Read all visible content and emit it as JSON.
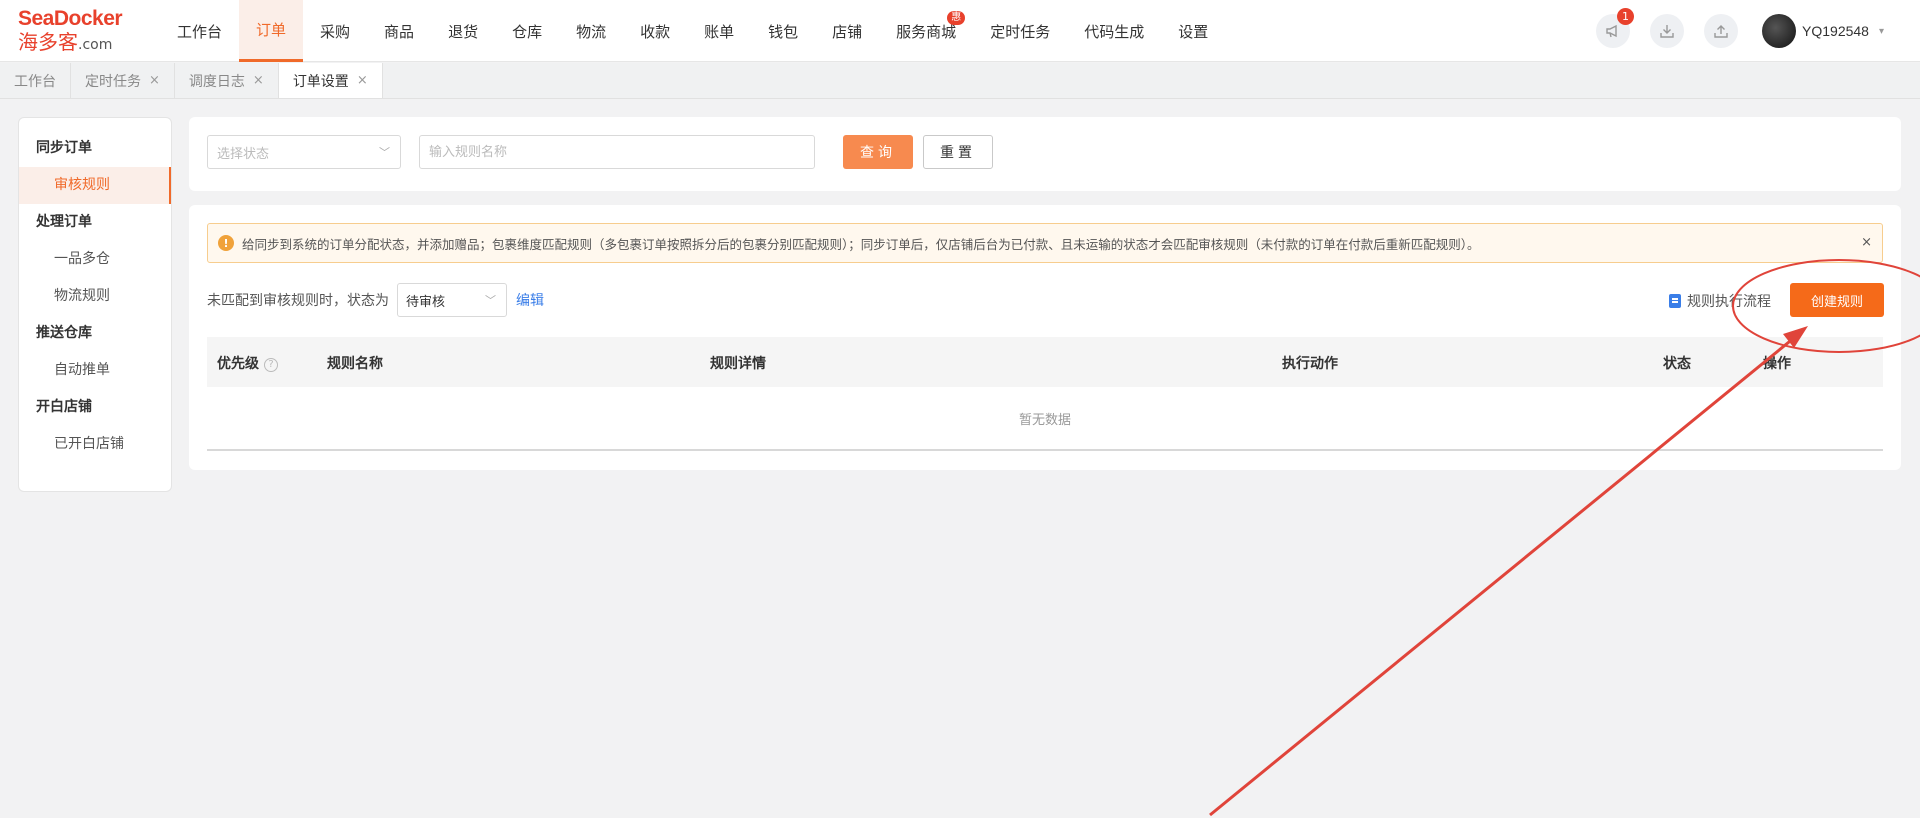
{
  "logo": {
    "line1_a": "Sea",
    "line1_b": "Docker",
    "line2_a": "海多客",
    "line2_b": ".com"
  },
  "nav": {
    "items": [
      {
        "label": "工作台"
      },
      {
        "label": "订单"
      },
      {
        "label": "采购"
      },
      {
        "label": "商品"
      },
      {
        "label": "退货"
      },
      {
        "label": "仓库"
      },
      {
        "label": "物流"
      },
      {
        "label": "收款"
      },
      {
        "label": "账单"
      },
      {
        "label": "钱包"
      },
      {
        "label": "店铺"
      },
      {
        "label": "服务商城",
        "badge": "惠"
      },
      {
        "label": "定时任务"
      },
      {
        "label": "代码生成"
      },
      {
        "label": "设置"
      }
    ],
    "active_index": 1
  },
  "toolbar": {
    "notice_badge": "1"
  },
  "user": {
    "name": "YQ192548"
  },
  "tabs": [
    {
      "label": "工作台",
      "closable": false
    },
    {
      "label": "定时任务",
      "closable": true
    },
    {
      "label": "调度日志",
      "closable": true
    },
    {
      "label": "订单设置",
      "closable": true,
      "active": true
    }
  ],
  "tab_close": "×",
  "sidebar": {
    "groups": [
      {
        "title": "同步订单",
        "items": [
          "审核规则"
        ]
      },
      {
        "title": "处理订单",
        "items": [
          "一品多仓",
          "物流规则"
        ]
      },
      {
        "title": "推送仓库",
        "items": [
          "自动推单"
        ]
      },
      {
        "title": "开白店铺",
        "items": [
          "已开白店铺"
        ]
      }
    ],
    "active_item": "审核规则"
  },
  "search": {
    "status_placeholder": "选择状态",
    "name_placeholder": "输入规则名称",
    "query_label": "查询",
    "reset_label": "重置"
  },
  "alert": {
    "icon": "!",
    "text": "给同步到系统的订单分配状态，并添加赠品；包裹维度匹配规则（多包裹订单按照拆分后的包裹分别匹配规则）；同步订单后，仅店铺后台为已付款、且未运输的状态才会匹配审核规则（未付款的订单在付款后重新匹配规则）。",
    "close": "×"
  },
  "default_status": {
    "label": "未匹配到审核规则时，状态为",
    "value": "待审核",
    "edit": "编辑"
  },
  "actions": {
    "flow_label": "规则执行流程",
    "create_label": "创建规则"
  },
  "table": {
    "columns": [
      "优先级",
      "规则名称",
      "规则详情",
      "执行动作",
      "状态",
      "操作"
    ],
    "help": "?",
    "empty_text": "暂无数据"
  },
  "colors": {
    "accent": "#f06a2a",
    "create_button": "#f56a19",
    "query_button": "#f78a4f",
    "link": "#3a7ee8",
    "annotation": "#e0443a"
  }
}
